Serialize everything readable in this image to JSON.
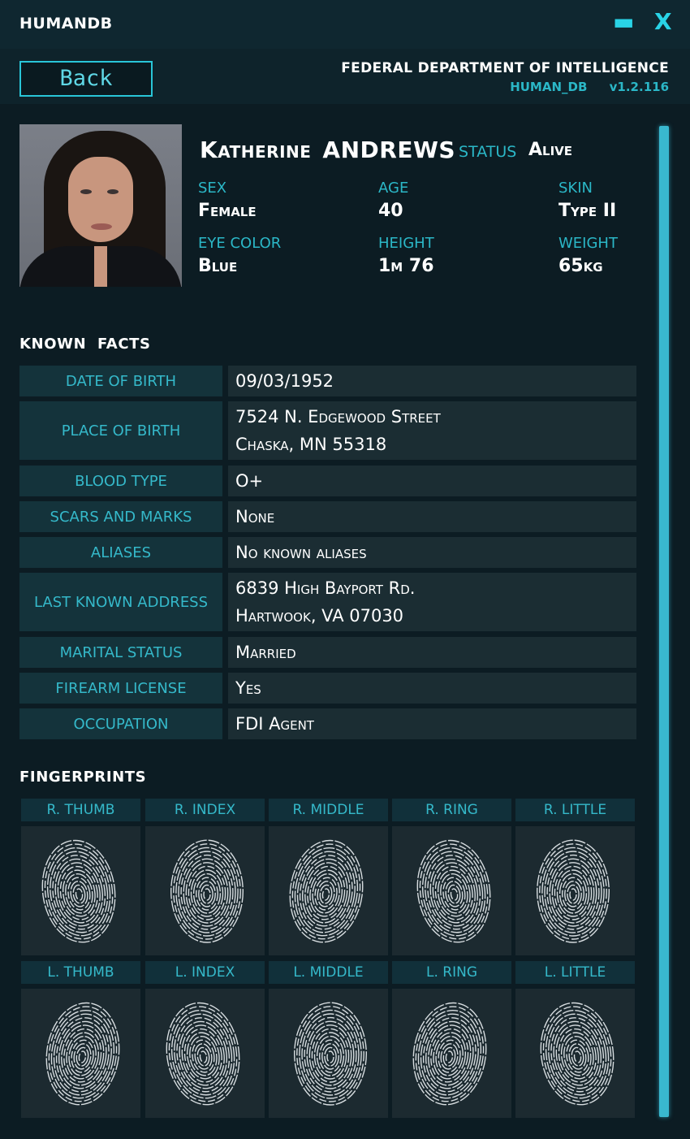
{
  "app": {
    "title": "HUMANDB",
    "minimize_glyph": "▬",
    "close_glyph": "X"
  },
  "header": {
    "back_label": "Back",
    "agency": "FEDERAL DEPARTMENT OF INTELLIGENCE",
    "db_name": "HUMAN_DB",
    "version": "v1.2.116"
  },
  "profile": {
    "first_name": "Katherine",
    "last_name": "ANDREWS",
    "status_label": "STATUS",
    "status_value": "Alive",
    "attributes": [
      {
        "label": "SEX",
        "value": "Female"
      },
      {
        "label": "AGE",
        "value": "40"
      },
      {
        "label": "SKIN",
        "value": "Type II"
      },
      {
        "label": "EYE COLOR",
        "value": "Blue"
      },
      {
        "label": "HEIGHT",
        "value": "1m 76"
      },
      {
        "label": "WEIGHT",
        "value": "65kg"
      }
    ]
  },
  "known_facts": {
    "title": "KNOWN  FACTS",
    "rows": [
      {
        "label": "DATE OF BIRTH",
        "lines": [
          "09/03/1952"
        ]
      },
      {
        "label": "PLACE OF BIRTH",
        "lines": [
          "7524 N. Edgewood Street",
          "Chaska, MN 55318"
        ]
      },
      {
        "label": "BLOOD TYPE",
        "lines": [
          "O+"
        ]
      },
      {
        "label": "SCARS AND MARKS",
        "lines": [
          "None"
        ]
      },
      {
        "label": "ALIASES",
        "lines": [
          "No known aliases"
        ]
      },
      {
        "label": "LAST KNOWN ADDRESS",
        "lines": [
          "6839 High Bayport Rd.",
          "Hartwook, VA 07030"
        ]
      },
      {
        "label": "MARITAL STATUS",
        "lines": [
          "Married"
        ]
      },
      {
        "label": "FIREARM LICENSE",
        "lines": [
          "Yes"
        ]
      },
      {
        "label": "OCCUPATION",
        "lines": [
          "FDI Agent"
        ]
      }
    ]
  },
  "fingerprints": {
    "title": "FINGERPRINTS",
    "right": [
      "R. THUMB",
      "R. INDEX",
      "R. MIDDLE",
      "R. RING",
      "R. LITTLE"
    ],
    "left": [
      "L. THUMB",
      "L. INDEX",
      "L. MIDDLE",
      "L. RING",
      "L. LITTLE"
    ]
  },
  "colors": {
    "accent": "#2bb7c7",
    "scrollbar": "#39b8cf",
    "background": "#0b1a21"
  },
  "icons": {
    "minimize": "minimize-icon",
    "close": "close-icon",
    "fingerprint": "fingerprint-icon"
  }
}
